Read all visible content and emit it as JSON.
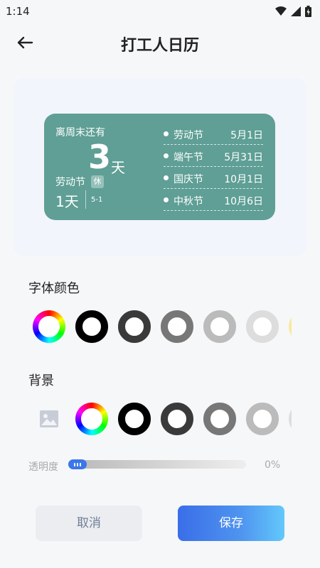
{
  "status_bar": {
    "time": "1:14"
  },
  "header": {
    "title": "打工人日历"
  },
  "widget": {
    "countdown_label": "离周末还有",
    "countdown_value": "3",
    "countdown_unit": "天",
    "next_holiday_name": "劳动节",
    "rest_badge": "休",
    "next_holiday_days": "1天",
    "next_holiday_date": "5-1",
    "holidays": [
      {
        "name": "劳动节",
        "date": "5月1日"
      },
      {
        "name": "端午节",
        "date": "5月31日"
      },
      {
        "name": "国庆节",
        "date": "10月1日"
      },
      {
        "name": "中秋节",
        "date": "10月6日"
      }
    ],
    "background_color": "#5f9f95"
  },
  "font_color": {
    "title": "字体颜色",
    "swatches": [
      "#000000",
      "#3a3a3a",
      "#777777",
      "#bbbbbb",
      "#dddddd",
      "#f7e9a0"
    ]
  },
  "background": {
    "title": "背景",
    "swatches": [
      "#000000",
      "#3a3a3a",
      "#777777",
      "#bbbbbb",
      "#dddddd"
    ]
  },
  "opacity": {
    "label": "透明度",
    "value": "0%",
    "fraction": 0
  },
  "buttons": {
    "cancel": "取消",
    "save": "保存"
  },
  "colors": {
    "accent": "#3a6ee8",
    "cancel_text": "#6f7e96"
  }
}
